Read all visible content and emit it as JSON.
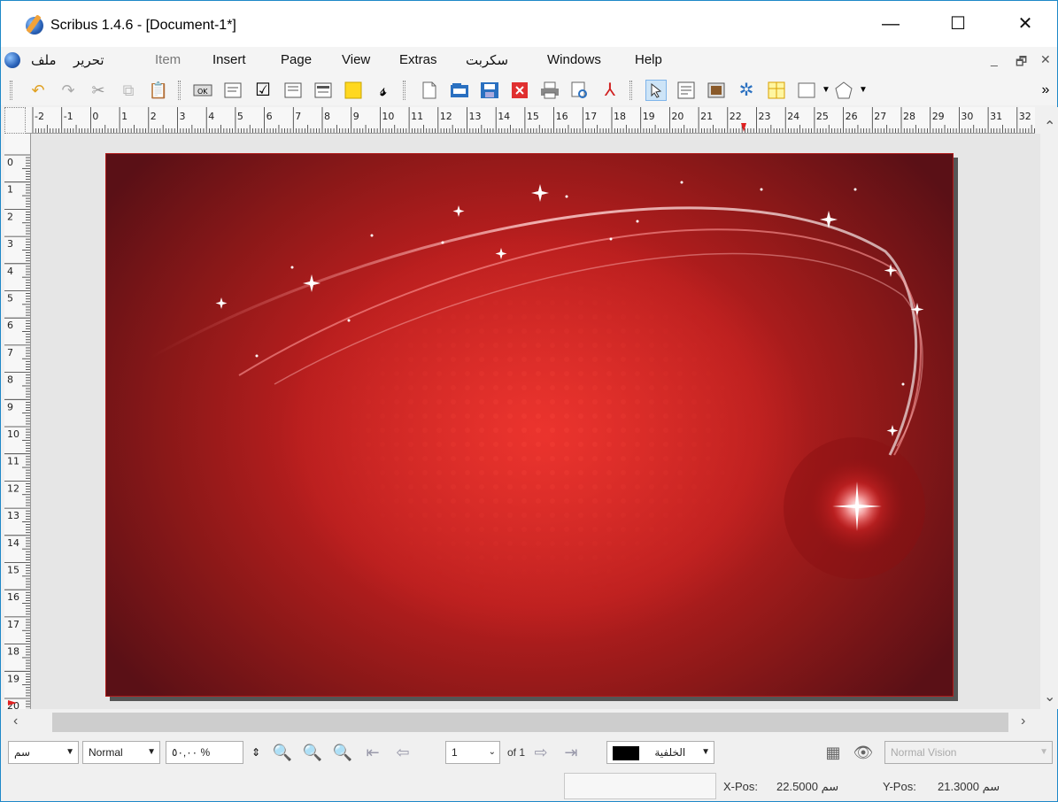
{
  "window": {
    "title": "Scribus 1.4.6 - [Document-1*]",
    "minimize": "—",
    "maximize": "☐",
    "close": "✕"
  },
  "menubar": {
    "items": [
      "ملف",
      "تحرير",
      "Item",
      "Insert",
      "Page",
      "View",
      "Extras",
      "سكربت",
      "Windows",
      "Help"
    ],
    "mdi_minimize": "_",
    "mdi_restore": "🗗",
    "mdi_close": "✕"
  },
  "toolbar": {
    "overflow": "»"
  },
  "ruler": {
    "h_labels": [
      "-2",
      "-1",
      "0",
      "1",
      "2",
      "3",
      "4",
      "5",
      "6",
      "7",
      "8",
      "9",
      "10",
      "11",
      "12",
      "13",
      "14",
      "15",
      "16",
      "17",
      "18",
      "19",
      "20",
      "21",
      "22",
      "23",
      "24",
      "25",
      "26",
      "27",
      "28",
      "29",
      "30",
      "31",
      "32"
    ],
    "v_labels": [
      "0",
      "1",
      "2",
      "3",
      "4",
      "5",
      "6",
      "7",
      "8",
      "9",
      "10",
      "11",
      "12",
      "13",
      "14",
      "15",
      "16",
      "17",
      "18",
      "19",
      "20"
    ]
  },
  "statusbar": {
    "unit": "سم",
    "image_mode": "Normal",
    "zoom": "٥٠,٠٠ %",
    "page_number": "1",
    "page_of": "of 1",
    "layer": "الخلفية",
    "vision_mode": "Normal Vision",
    "xpos_label": "X-Pos:",
    "xpos_value": "22.5000 سم",
    "ypos_label": "Y-Pos:",
    "ypos_value": "21.3000 سم"
  },
  "colors": {
    "page_red": "#c82424",
    "page_dark": "#5a1016",
    "layer_swatch": "#000000",
    "selection_blue": "#cde4f7"
  }
}
